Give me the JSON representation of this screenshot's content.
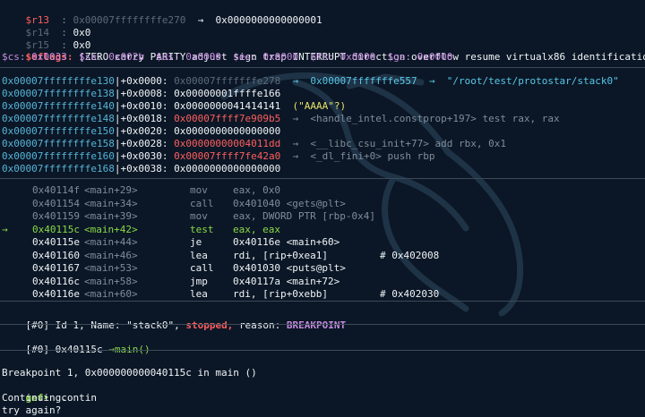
{
  "registers": [
    {
      "name": "$r13",
      "val": "0x00007ffffffffe270",
      "arrow": "→",
      "deref": "0x0000000000000001"
    },
    {
      "name": "$r14",
      "val": "0x0"
    },
    {
      "name": "$r15",
      "val": "0x0"
    }
  ],
  "eflags": {
    "label": "$eflags:",
    "value": "[ZERO carry PARITY adjust sign trap INTERRUPT direction overflow resume virtualx86 identification]"
  },
  "segments": "$cs: 0x0033  $ss: 0x002b  $ds: 0x0000  $es: 0x0000  $fs: 0x0000  $gs: 0x0000",
  "stack": [
    {
      "addr": "0x00007ffffffffe130",
      "off": "+0x0000:",
      "val": "0x00007fffffffe278",
      "rest": "→  0x00007fffffffe557  →  \"/root/test/protostar/stack0\"",
      "vc": "dim",
      "rc": "cyan"
    },
    {
      "addr": "0x00007ffffffffe138",
      "off": "+0x0008:",
      "val": "0x00000001ffffe166",
      "rest": "",
      "vc": "white",
      "rc": "white"
    },
    {
      "addr": "0x00007ffffffffe140",
      "off": "+0x0010:",
      "val": "0x0000000041414141",
      "rest": "(\"AAAA\"?)",
      "vc": "white",
      "rc": "yellow"
    },
    {
      "addr": "0x00007ffffffffe148",
      "off": "+0x0018:",
      "val": "0x00007ffff7e909b5",
      "rest": "→  <handle_intel.constprop+197> test rax, rax",
      "vc": "red",
      "rc": "grey"
    },
    {
      "addr": "0x00007ffffffffe150",
      "off": "+0x0020:",
      "val": "0x0000000000000000",
      "rest": "",
      "vc": "white",
      "rc": "white"
    },
    {
      "addr": "0x00007ffffffffe158",
      "off": "+0x0028:",
      "val": "0x00000000004011dd",
      "rest": "→  <__libc_csu_init+77> add rbx, 0x1",
      "vc": "red",
      "rc": "grey"
    },
    {
      "addr": "0x00007ffffffffe160",
      "off": "+0x0030:",
      "val": "0x00007ffff7fe42a0",
      "rest": "→  <_dl_fini+0> push rbp",
      "vc": "red",
      "rc": "grey"
    },
    {
      "addr": "0x00007ffffffffe168",
      "off": "+0x0038:",
      "val": "0x0000000000000000",
      "rest": "",
      "vc": "white",
      "rc": "white"
    }
  ],
  "code": [
    {
      "mark": "",
      "addr": "0x40114f",
      "sym": "<main+29>",
      "op": "mov",
      "args": "eax, 0x0",
      "cmt": "",
      "cls": "grey"
    },
    {
      "mark": "",
      "addr": "0x401154",
      "sym": "<main+34>",
      "op": "call",
      "args": "0x401040 <gets@plt>",
      "cmt": "",
      "cls": "grey"
    },
    {
      "mark": "",
      "addr": "0x401159",
      "sym": "<main+39>",
      "op": "mov",
      "args": "eax, DWORD PTR [rbp-0x4]",
      "cmt": "",
      "cls": "grey"
    },
    {
      "mark": "→",
      "addr": "0x40115c",
      "sym": "<main+42>",
      "op": "test",
      "args": "eax, eax",
      "cmt": "",
      "cls": "green"
    },
    {
      "mark": "",
      "addr": "0x40115e",
      "sym": "<main+44>",
      "op": "je",
      "args": "0x40116e <main+60>",
      "cmt": "",
      "cls": "white"
    },
    {
      "mark": "",
      "addr": "0x401160",
      "sym": "<main+46>",
      "op": "lea",
      "args": "rdi, [rip+0xea1]",
      "cmt": "# 0x402008",
      "cls": "white"
    },
    {
      "mark": "",
      "addr": "0x401167",
      "sym": "<main+53>",
      "op": "call",
      "args": "0x401030 <puts@plt>",
      "cmt": "",
      "cls": "white"
    },
    {
      "mark": "",
      "addr": "0x40116c",
      "sym": "<main+58>",
      "op": "jmp",
      "args": "0x40117a <main+72>",
      "cmt": "",
      "cls": "white"
    },
    {
      "mark": "",
      "addr": "0x40116e",
      "sym": "<main+60>",
      "op": "lea",
      "args": "rdi, [rip+0xebb]",
      "cmt": "# 0x402030",
      "cls": "white"
    }
  ],
  "thread": {
    "idx": "[#0]",
    "pre": "Id 1, Name: \"stack0\",",
    "state": "stopped,",
    "reason_label": "reason:",
    "reason": "BREAKPOINT"
  },
  "trace": {
    "idx": "[#0]",
    "addr": "0x40115c",
    "arrow": "→",
    "func": "main()"
  },
  "console": [
    {
      "text": "Breakpoint 1, 0x000000000040115c in main ()"
    },
    {
      "prompt": "gef➤",
      "text": "  contin"
    },
    {
      "text": "Continuing."
    },
    {
      "text": "try again?"
    }
  ]
}
